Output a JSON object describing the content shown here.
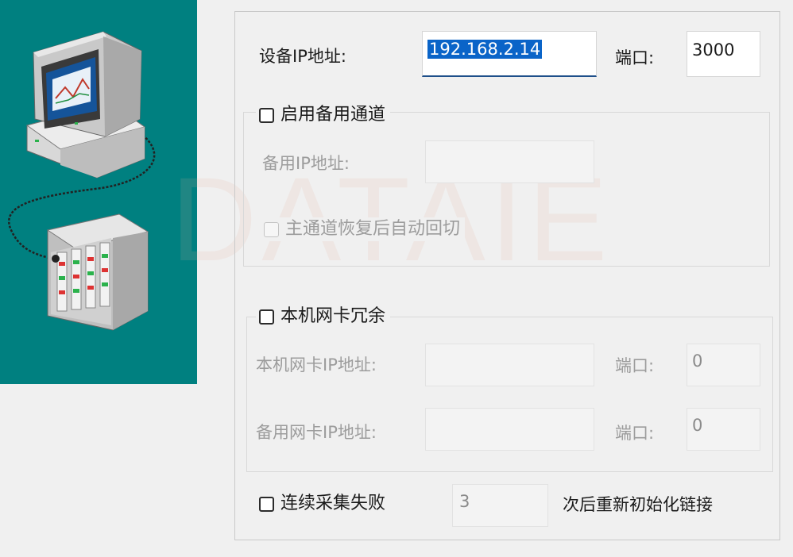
{
  "main": {
    "device_ip_label": "设备IP地址:",
    "device_ip_value": "192.168.2.14",
    "port_label": "端口:",
    "port_value": "3000"
  },
  "backup_channel": {
    "checkbox_label": "启用备用通道",
    "backup_ip_label": "备用IP地址:",
    "backup_ip_value": "",
    "auto_switchback_label": "主通道恢复后自动回切"
  },
  "nic_redundancy": {
    "checkbox_label": "本机网卡冗余",
    "local_nic_ip_label": "本机网卡IP地址:",
    "local_nic_ip_value": "",
    "local_port_label": "端口:",
    "local_port_value": "0",
    "backup_nic_ip_label": "备用网卡IP地址:",
    "backup_nic_ip_value": "",
    "backup_port_label": "端口:",
    "backup_port_value": "0"
  },
  "reinit": {
    "checkbox_label": "连续采集失败",
    "count_value": "3",
    "suffix_label": "次后重新初始化链接"
  },
  "watermark_text": "DATAIE",
  "colors": {
    "illustration_bg": "#008080",
    "selection_bg": "#0a64c8",
    "window_bg": "#f0f0f0"
  }
}
